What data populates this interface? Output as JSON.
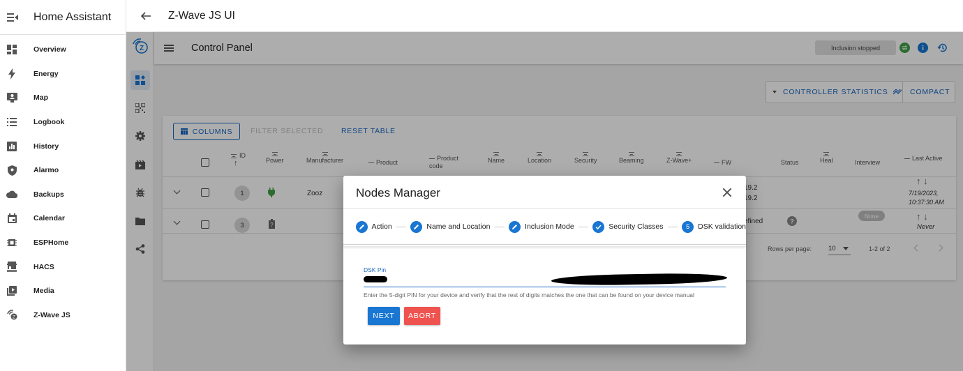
{
  "ha": {
    "title": "Home Assistant",
    "nav": [
      {
        "label": "Overview",
        "icon": "overview-icon"
      },
      {
        "label": "Energy",
        "icon": "energy-icon"
      },
      {
        "label": "Map",
        "icon": "map-icon"
      },
      {
        "label": "Logbook",
        "icon": "logbook-icon"
      },
      {
        "label": "History",
        "icon": "history-icon"
      },
      {
        "label": "Alarmo",
        "icon": "alarmo-icon"
      },
      {
        "label": "Backups",
        "icon": "backups-icon"
      },
      {
        "label": "Calendar",
        "icon": "calendar-icon"
      },
      {
        "label": "ESPHome",
        "icon": "esphome-icon"
      },
      {
        "label": "HACS",
        "icon": "hacs-icon"
      },
      {
        "label": "Media",
        "icon": "media-icon"
      },
      {
        "label": "Z-Wave JS",
        "icon": "zwave-icon"
      }
    ]
  },
  "topbar": {
    "title": "Z-Wave JS UI"
  },
  "zui": {
    "appbar_title": "Control Panel",
    "inclusion_status": "Inclusion stopped",
    "controller_stats_label": "CONTROLLER STATISTICS",
    "compact_label": "COMPACT",
    "toolbar": {
      "columns": "COLUMNS",
      "filter": "FILTER SELECTED",
      "reset": "RESET TABLE"
    },
    "headers": [
      "ID",
      "Power",
      "Manufacturer",
      "Product",
      "Product code",
      "Name",
      "Location",
      "Security",
      "Beaming",
      "Z-Wave+",
      "FW",
      "Status",
      "Heal",
      "Interview",
      "Last Active"
    ],
    "rows": [
      {
        "id": "1",
        "manufacturer": "Zooz",
        "fw_a": "19.2",
        "fw_b": "19.2",
        "last_active_date": "7/19/2023,",
        "last_active_time": "10:37:30 AM"
      },
      {
        "id": "3",
        "fw_partial": "efined",
        "interview_badge": "None",
        "last_active": "Never"
      }
    ],
    "footer": {
      "rows_per_page_label": "Rows per page:",
      "rows_per_page_value": "10",
      "range": "1-2 of 2"
    }
  },
  "dialog": {
    "title": "Nodes Manager",
    "steps": [
      {
        "label": "Action",
        "icon": "pencil-icon"
      },
      {
        "label": "Name and Location",
        "icon": "pencil-icon"
      },
      {
        "label": "Inclusion Mode",
        "icon": "pencil-icon"
      },
      {
        "label": "Security Classes",
        "icon": "check-icon"
      },
      {
        "label": "DSK validation",
        "number": "5"
      }
    ],
    "dsk_label": "DSK Pin",
    "hint": "Enter the 5-digit PIN for your device and verify that the rest of digits matches the one that can be found on your device manual",
    "next_label": "NEXT",
    "abort_label": "ABORT"
  },
  "colors": {
    "primary": "#1976d2",
    "abort": "#ef5350"
  }
}
